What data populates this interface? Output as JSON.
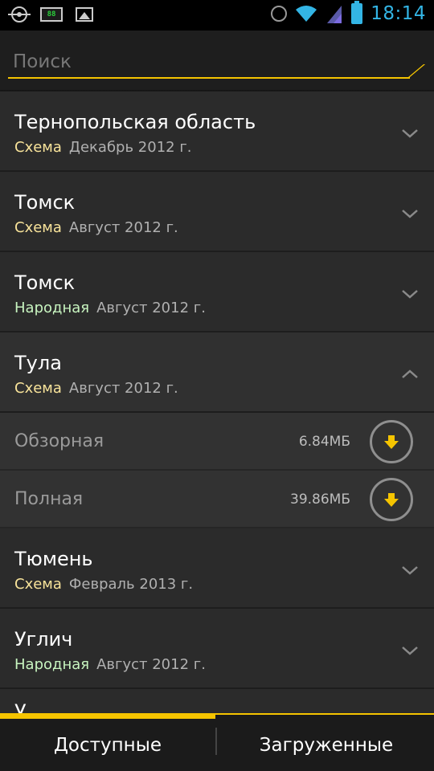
{
  "status_bar": {
    "time": "18:14",
    "left_icons": [
      "gps-icon",
      "battery-indicator-icon",
      "image-icon"
    ],
    "right_icons": [
      "alarm-icon",
      "wifi-icon",
      "signal-icon",
      "battery-icon"
    ],
    "small_badge": "88"
  },
  "search": {
    "placeholder": "Поиск",
    "value": ""
  },
  "colors": {
    "accent": "#f5c400",
    "scheme": "#f8e39a",
    "folk": "#c8f5c0",
    "clock": "#33b5e5"
  },
  "regions": [
    {
      "title": "Тернопольская область",
      "type": "Схема",
      "date": "Декабрь 2012 г.",
      "expanded": false
    },
    {
      "title": "Томск",
      "type": "Схема",
      "date": "Август 2012 г.",
      "expanded": false
    },
    {
      "title": "Томск",
      "type": "Народная",
      "date": "Август 2012 г.",
      "expanded": false
    },
    {
      "title": "Тула",
      "type": "Схема",
      "date": "Август 2012 г.",
      "expanded": true,
      "downloads": [
        {
          "label": "Обзорная",
          "size": "6.84МБ"
        },
        {
          "label": "Полная",
          "size": "39.86МБ"
        }
      ]
    },
    {
      "title": "Тюмень",
      "type": "Схема",
      "date": "Февраль 2013 г.",
      "expanded": false
    },
    {
      "title": "Углич",
      "type": "Народная",
      "date": "Август 2012 г.",
      "expanded": false
    }
  ],
  "peek_row": "У",
  "tabs": [
    {
      "label": "Доступные",
      "active": true
    },
    {
      "label": "Загруженные",
      "active": false
    }
  ]
}
